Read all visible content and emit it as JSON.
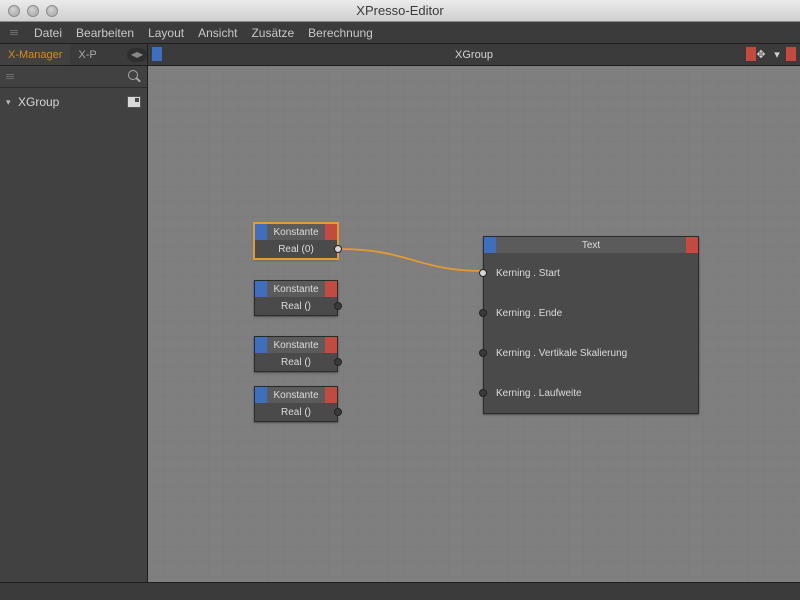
{
  "window": {
    "title": "XPresso-Editor"
  },
  "menubar": {
    "items": [
      "Datei",
      "Bearbeiten",
      "Layout",
      "Ansicht",
      "Zusätze",
      "Berechnung"
    ]
  },
  "sidebar": {
    "tabs": [
      {
        "label": "X-Manager",
        "active": true
      },
      {
        "label": "X-P",
        "active": false
      }
    ],
    "tree": {
      "root_label": "XGroup"
    }
  },
  "editor": {
    "header": "XGroup"
  },
  "nodes": {
    "konstante": [
      {
        "title": "Konstante",
        "value": "Real (0)",
        "selected": true,
        "port_filled": true
      },
      {
        "title": "Konstante",
        "value": "Real ()",
        "selected": false,
        "port_filled": false
      },
      {
        "title": "Konstante",
        "value": "Real ()",
        "selected": false,
        "port_filled": false
      },
      {
        "title": "Konstante",
        "value": "Real ()",
        "selected": false,
        "port_filled": false
      }
    ],
    "text": {
      "title": "Text",
      "inputs": [
        {
          "label": "Kerning . Start",
          "filled": true
        },
        {
          "label": "Kerning . Ende",
          "filled": false
        },
        {
          "label": "Kerning . Vertikale Skalierung",
          "filled": false
        },
        {
          "label": "Kerning . Laufweite",
          "filled": false
        }
      ]
    }
  }
}
